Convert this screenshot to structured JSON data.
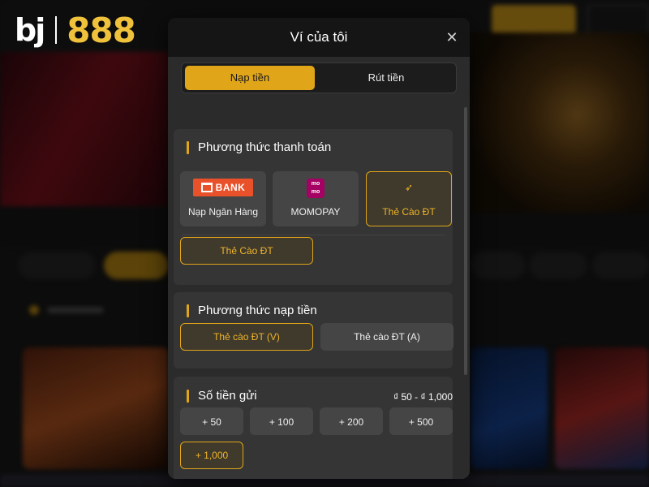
{
  "brand": {
    "name_left": "bj",
    "name_right": "888"
  },
  "modal": {
    "title": "Ví của tôi",
    "close_icon": "close-icon",
    "tabs": [
      {
        "label": "Nạp tiền",
        "active": true
      },
      {
        "label": "Rút tiền",
        "active": false
      }
    ]
  },
  "payment_section": {
    "title": "Phương thức thanh toán",
    "methods": [
      {
        "label": "Nạp Ngân Hàng",
        "icon": "bank-icon",
        "icon_text": "BANK",
        "active": false
      },
      {
        "label": "MOMOPAY",
        "icon": "momo-icon",
        "icon_text": "mo mo",
        "active": false
      },
      {
        "label": "Thẻ Cào ĐT",
        "icon": "phone-card-icon",
        "active": true
      }
    ],
    "sub_option": "Thẻ Cào ĐT"
  },
  "deposit_section": {
    "title": "Phương thức nạp tiền",
    "options": [
      {
        "label": "Thẻ cào ĐT (V)",
        "selected": true
      },
      {
        "label": "Thẻ cào ĐT (A)",
        "selected": false
      }
    ]
  },
  "amount_section": {
    "title": "Số tiền gửi",
    "range": "₫ 50 - ₫ 1,000",
    "amounts": [
      "+ 50",
      "+ 100",
      "+ 200",
      "+ 500",
      "+ 1,000"
    ],
    "selected_amount": "+ 1,000"
  },
  "colors": {
    "accent": "#e1a519",
    "panel": "#353535",
    "header": "#151515"
  }
}
